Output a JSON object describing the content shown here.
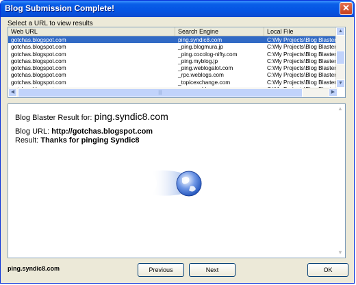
{
  "window": {
    "title": "Blog Submission Complete!"
  },
  "hint": "Select a URL to view results",
  "columns": [
    "Web URL",
    "Search Engine",
    "Local File"
  ],
  "rows": [
    [
      "gotchas.blogspot.com",
      "ping.syndic8.com",
      "C:\\My Projects\\Blog Blaster\\B"
    ],
    [
      "gotchas.blogspot.com",
      "_ping.blogmura.jp",
      "C:\\My Projects\\Blog Blaster\\B"
    ],
    [
      "gotchas.blogspot.com",
      "_ping.cocolog-nifty.com",
      "C:\\My Projects\\Blog Blaster\\B"
    ],
    [
      "gotchas.blogspot.com",
      "_ping.myblog.jp",
      "C:\\My Projects\\Blog Blaster\\B"
    ],
    [
      "gotchas.blogspot.com",
      "_ping.weblogalot.com",
      "C:\\My Projects\\Blog Blaster\\B"
    ],
    [
      "gotchas.blogspot.com",
      "_rpc.weblogs.com",
      "C:\\My Projects\\Blog Blaster\\B"
    ],
    [
      "gotchas.blogspot.com",
      "_topicexchange.com",
      "C:\\My Projects\\Blog Blaster\\B"
    ],
    [
      "gotchas.blogspot.com",
      "_www.weblogues.com",
      "C:\\My Projects\\Blog Blaster\\B"
    ]
  ],
  "selected_row": 0,
  "result": {
    "label": "Blog Blaster Result for:",
    "engine": "ping.syndic8.com",
    "blog_url_label": "Blog URL:",
    "blog_url": "http://gotchas.blogspot.com",
    "result_label": "Result:",
    "result_text": "Thanks for pinging Syndic8"
  },
  "status": "ping.syndic8.com",
  "buttons": {
    "previous": "Previous",
    "next": "Next",
    "ok": "OK"
  },
  "icons": {
    "close": "close-icon",
    "globe": "globe-icon"
  },
  "colors": {
    "selection": "#316ac5",
    "titlebar": "#0554e3"
  }
}
